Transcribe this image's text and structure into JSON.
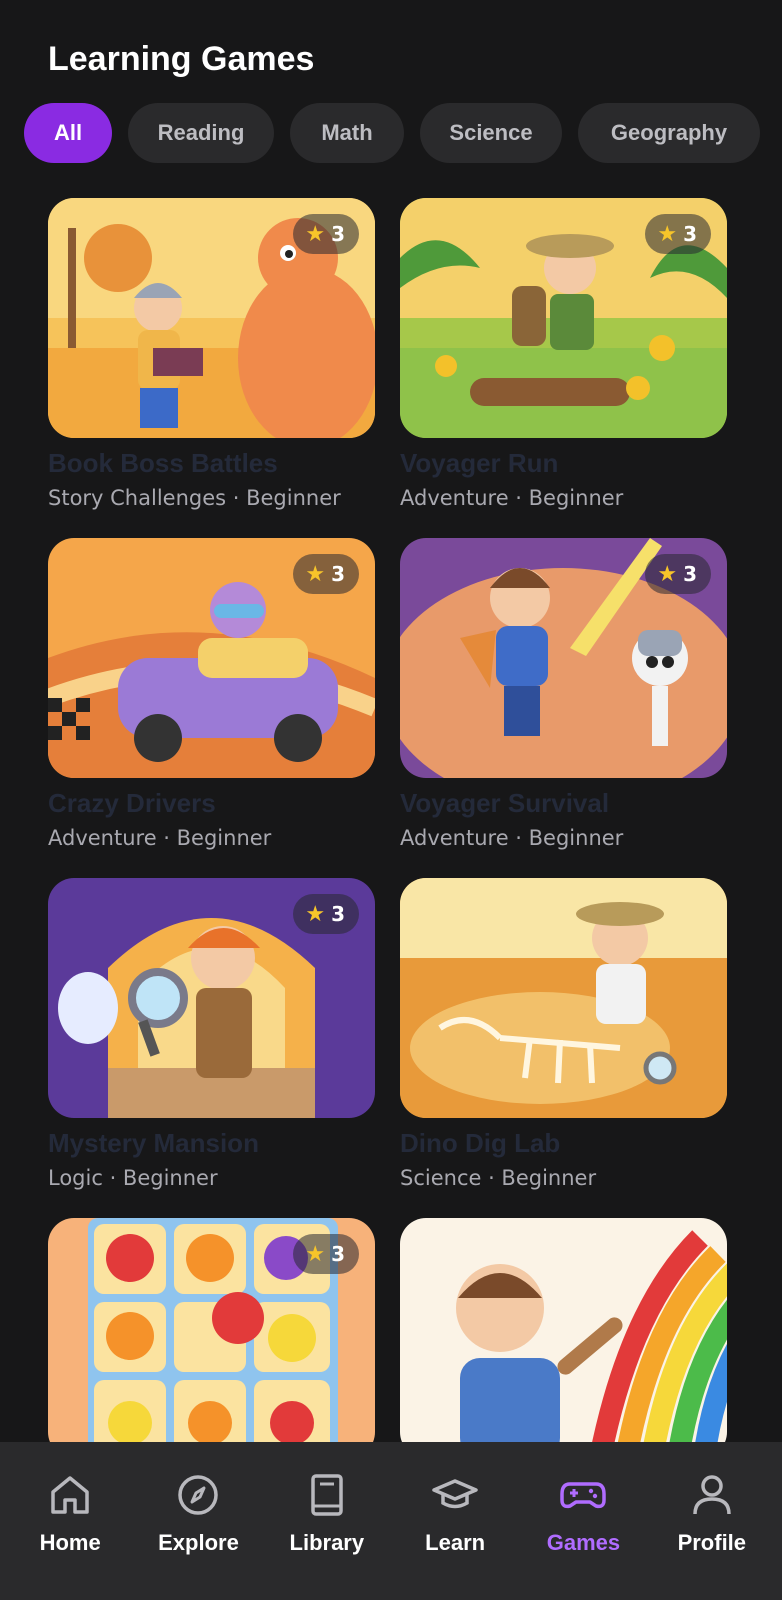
{
  "header": {
    "title": "Learning Games"
  },
  "filters": [
    {
      "label": "All",
      "active": true
    },
    {
      "label": "Reading",
      "active": false
    },
    {
      "label": "Math",
      "active": false
    },
    {
      "label": "Science",
      "active": false
    },
    {
      "label": "Geography",
      "active": false
    }
  ],
  "games": [
    {
      "title": "Book Boss Battles",
      "meta": "Story Challenges · Beginner",
      "rating": "3",
      "illustration": "knight-reading-book-dragon"
    },
    {
      "title": "Voyager Run",
      "meta": "Adventure · Beginner",
      "rating": "3",
      "illustration": "explorer-running-jungle-coins"
    },
    {
      "title": "Crazy Drivers",
      "meta": "Adventure · Beginner",
      "rating": "3",
      "illustration": "kid-racing-car-track"
    },
    {
      "title": "Voyager Survival",
      "meta": "Adventure · Beginner",
      "rating": "3",
      "illustration": "hero-sword-skeleton"
    },
    {
      "title": "Mystery Mansion",
      "meta": "Logic · Beginner",
      "rating": "3",
      "illustration": "detective-magnifier-ghost"
    },
    {
      "title": "Dino Dig Lab",
      "meta": "Science · Beginner",
      "rating": "",
      "illustration": "kid-digging-dinosaur-fossil"
    },
    {
      "title": "",
      "meta": "",
      "rating": "3",
      "illustration": "fruit-match-puzzle"
    },
    {
      "title": "",
      "meta": "",
      "rating": "",
      "illustration": "kid-painting-rainbow"
    }
  ],
  "tabbar": [
    {
      "label": "Home",
      "icon": "home-icon",
      "active": false
    },
    {
      "label": "Explore",
      "icon": "compass-icon",
      "active": false
    },
    {
      "label": "Library",
      "icon": "book-icon",
      "active": false
    },
    {
      "label": "Learn",
      "icon": "graduation-cap-icon",
      "active": false
    },
    {
      "label": "Games",
      "icon": "gamepad-icon",
      "active": true
    },
    {
      "label": "Profile",
      "icon": "person-icon",
      "active": false
    }
  ],
  "colors": {
    "accent": "#8a2be2",
    "accent_text": "#b06cff",
    "background": "#171718",
    "bar": "#2a2a2c"
  }
}
